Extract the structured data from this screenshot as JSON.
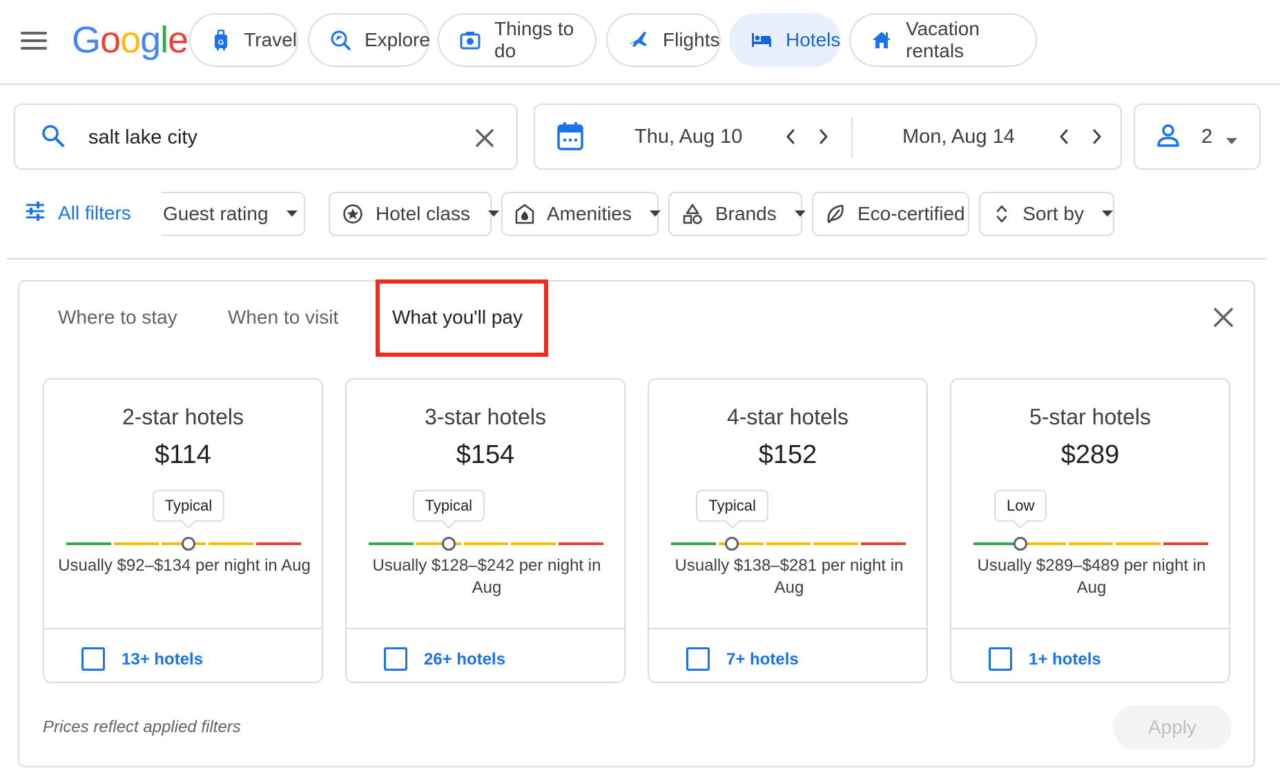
{
  "header": {
    "logo_text": "Google",
    "nav_tabs": [
      {
        "label": "Travel",
        "icon": "luggage-icon",
        "active": false
      },
      {
        "label": "Explore",
        "icon": "explore-icon",
        "active": false
      },
      {
        "label": "Things to do",
        "icon": "camera-icon",
        "active": false
      },
      {
        "label": "Flights",
        "icon": "airplane-icon",
        "active": false
      },
      {
        "label": "Hotels",
        "icon": "bed-icon",
        "active": true
      },
      {
        "label": "Vacation rentals",
        "icon": "house-icon",
        "active": false
      }
    ]
  },
  "search": {
    "value": "salt lake city",
    "icon": "search-icon",
    "clear_icon": "close-icon"
  },
  "dates": {
    "check_in": "Thu, Aug 10",
    "check_out": "Mon, Aug 14",
    "icon": "calendar-icon"
  },
  "guests": {
    "count": "2",
    "icon": "person-icon"
  },
  "filters": {
    "all_filters_label": "All filters",
    "chips": [
      {
        "label": "Guest rating",
        "icon": "",
        "caret": true
      },
      {
        "label": "Hotel class",
        "icon": "star-circle-icon",
        "caret": true
      },
      {
        "label": "Amenities",
        "icon": "amenities-icon",
        "caret": true
      },
      {
        "label": "Brands",
        "icon": "shapes-icon",
        "caret": true
      },
      {
        "label": "Eco-certified",
        "icon": "leaf-icon",
        "caret": false
      },
      {
        "label": "Sort by",
        "icon": "sort-icon",
        "caret": true
      }
    ]
  },
  "insights": {
    "tabs": [
      {
        "label": "Where to stay",
        "active": false
      },
      {
        "label": "When to visit",
        "active": false
      },
      {
        "label": "What you'll pay",
        "active": true
      }
    ],
    "cards": [
      {
        "title": "2-star hotels",
        "price": "$114",
        "tag": "Typical",
        "range_text": "Usually $92–$134 per night in Aug",
        "count": "13+ hotels",
        "marker_fraction": 0.52
      },
      {
        "title": "3-star hotels",
        "price": "$154",
        "tag": "Typical",
        "range_text": "Usually $128–$242 per night in Aug",
        "count": "26+ hotels",
        "marker_fraction": 0.34
      },
      {
        "title": "4-star hotels",
        "price": "$152",
        "tag": "Typical",
        "range_text": "Usually $138–$281 per night in Aug",
        "count": "7+ hotels",
        "marker_fraction": 0.26
      },
      {
        "title": "5-star hotels",
        "price": "$289",
        "tag": "Low",
        "range_text": "Usually $289–$489 per night in Aug",
        "count": "1+ hotels",
        "marker_fraction": 0.2
      }
    ],
    "note": "Prices reflect applied filters",
    "apply_label": "Apply"
  },
  "colors": {
    "accent": "#1a73e8",
    "active_tab_bg": "#e8f0fe",
    "highlight": "#ea2d1e",
    "bar_green": "#34a853",
    "bar_yellow": "#fbbc04",
    "bar_red": "#ea4335"
  }
}
